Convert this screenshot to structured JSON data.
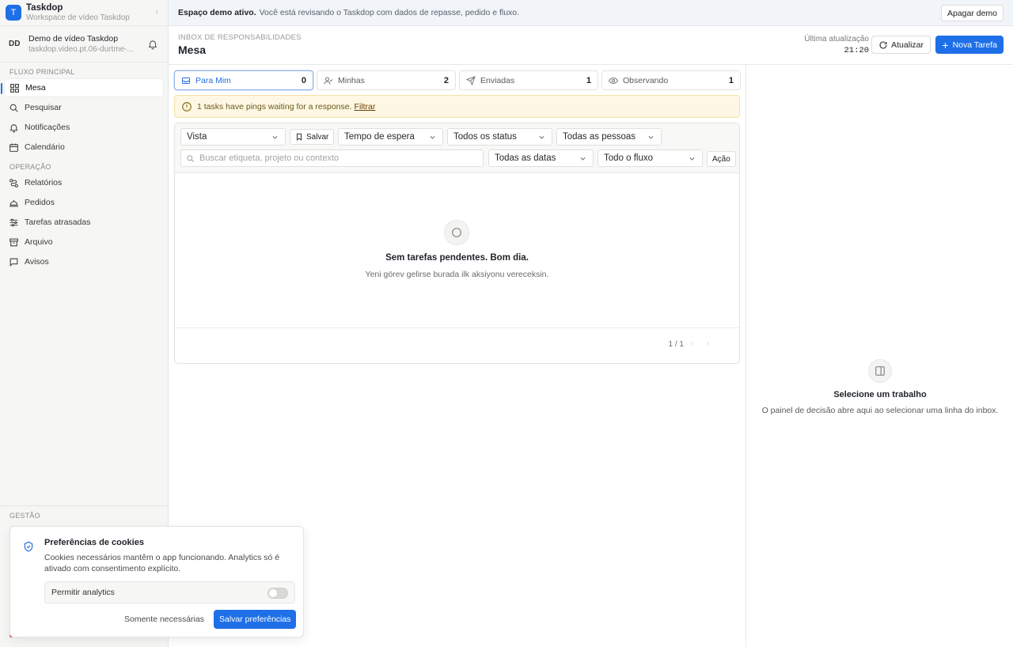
{
  "brand": {
    "title": "Taskdop",
    "subtitle": "Workspace de vídeo Taskdop"
  },
  "user": {
    "initials": "DD",
    "name": "Demo de vídeo Taskdop",
    "email": "taskdop.video.pt.06-durtme-..."
  },
  "sidebar": {
    "section_main": "FLUXO PRINCIPAL",
    "main_items": [
      {
        "label": "Mesa",
        "icon": "grid-icon"
      },
      {
        "label": "Pesquisar",
        "icon": "search-icon"
      },
      {
        "label": "Notificações",
        "icon": "bell-icon"
      },
      {
        "label": "Calendário",
        "icon": "calendar-icon"
      }
    ],
    "section_ops": "OPERAÇÃO",
    "ops_items": [
      {
        "label": "Relatórios",
        "icon": "route-icon"
      },
      {
        "label": "Pedidos",
        "icon": "bell-service-icon"
      },
      {
        "label": "Tarefas atrasadas",
        "icon": "sliders-icon"
      },
      {
        "label": "Arquivo",
        "icon": "archive-icon"
      },
      {
        "label": "Avisos",
        "icon": "message-icon"
      }
    ],
    "section_gestao": "GESTÃO"
  },
  "banner": {
    "bold": "Espaço demo ativo.",
    "text": "Você está revisando o Taskdop com dados de repasse, pedido e fluxo.",
    "button": "Apagar demo"
  },
  "header": {
    "eyebrow": "INBOX DE RESPONSABILIDADES",
    "title": "Mesa",
    "updated_label": "Última atualização",
    "updated_time": "21:20",
    "refresh": "Atualizar",
    "new_task": "Nova Tarefa"
  },
  "tabs": [
    {
      "label": "Para Mim",
      "count": "0",
      "icon": "inbox-icon"
    },
    {
      "label": "Minhas",
      "count": "2",
      "icon": "user-check-icon"
    },
    {
      "label": "Enviadas",
      "count": "1",
      "icon": "send-icon"
    },
    {
      "label": "Observando",
      "count": "1",
      "icon": "eye-icon"
    }
  ],
  "alert": {
    "text": "1 tasks have pings waiting for a response.",
    "link": "Filtrar"
  },
  "filters": {
    "view": "Vista",
    "save": "Salvar",
    "wait": "Tempo de espera",
    "status": "Todos os status",
    "people": "Todas as pessoas",
    "search_placeholder": "Buscar etiqueta, projeto ou contexto",
    "dates": "Todas as datas",
    "flow": "Todo o fluxo",
    "action": "Ação"
  },
  "empty": {
    "title": "Sem tarefas pendentes. Bom dia.",
    "subtitle": "Yeni görev gelirse burada ilk aksiyonu vereceksin."
  },
  "pager": "1 / 1",
  "detail": {
    "title": "Selecione um trabalho",
    "subtitle": "O painel de decisão abre aqui ao selecionar uma linha do inbox."
  },
  "cookie": {
    "title": "Preferências de cookies",
    "text": "Cookies necessários mantêm o app funcionando. Analytics só é ativado com consentimento explícito.",
    "toggle_label": "Permitir analytics",
    "secondary": "Somente necessárias",
    "primary": "Salvar preferências"
  },
  "colors": {
    "accent": "#1e6fe8",
    "alert_bg": "#fdf7e3"
  }
}
